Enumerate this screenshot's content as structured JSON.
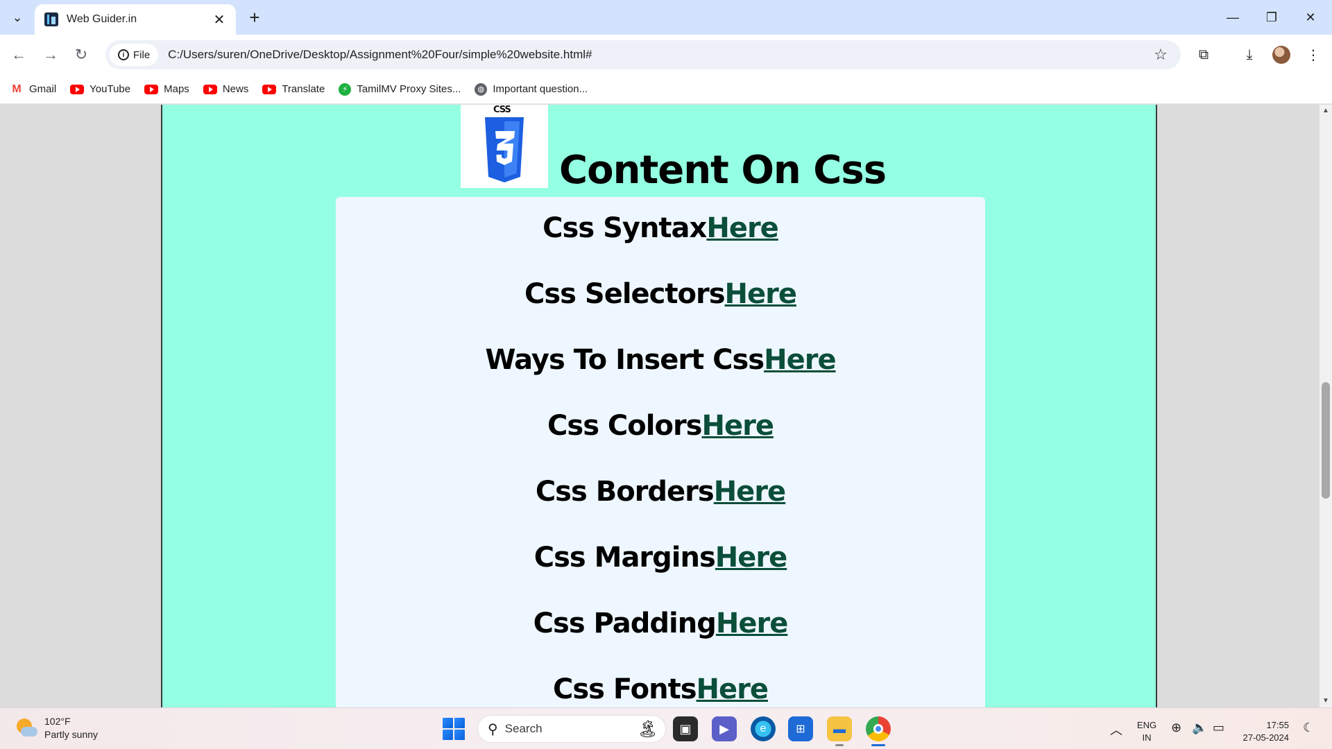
{
  "browser": {
    "tab_title": "Web Guider.in",
    "new_tab_symbol": "+",
    "close_symbol": "✕",
    "address": {
      "chip_label": "File",
      "url": "C:/Users/suren/OneDrive/Desktop/Assignment%20Four/simple%20website.html#"
    },
    "bookmarks": [
      {
        "label": "Gmail",
        "icon": "gmail-icon"
      },
      {
        "label": "YouTube",
        "icon": "youtube-icon"
      },
      {
        "label": "Maps",
        "icon": "youtube-icon"
      },
      {
        "label": "News",
        "icon": "youtube-icon"
      },
      {
        "label": "Translate",
        "icon": "youtube-icon"
      },
      {
        "label": "TamilMV Proxy Sites...",
        "icon": "bolt-icon"
      },
      {
        "label": "Important question...",
        "icon": "globe-icon"
      }
    ]
  },
  "page": {
    "logo_label": "CSS",
    "heading": "Content On Css",
    "link_text": "Here",
    "link_color": "#0b4e3a",
    "panel_color": "#94ffe2",
    "card_color": "#eef7ff",
    "topics": [
      "Css Syntax",
      "Css Selectors",
      "Ways To Insert Css",
      "Css Colors",
      "Css Borders",
      "Css Margins",
      "Css Padding",
      "Css Fonts"
    ]
  },
  "taskbar": {
    "weather": {
      "temp": "102°F",
      "condition": "Partly sunny"
    },
    "search_placeholder": "Search",
    "language": {
      "line1": "ENG",
      "line2": "IN"
    },
    "time": "17:55",
    "date": "27-05-2024"
  }
}
